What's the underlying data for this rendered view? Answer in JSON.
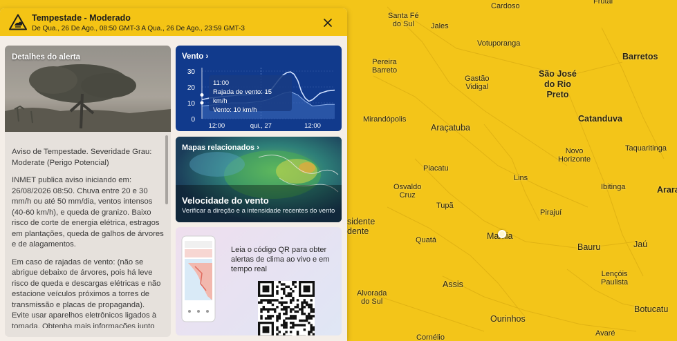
{
  "alert": {
    "title": "Tempestade - Moderado",
    "period": "De Qua., 26 De Ago., 08:50 GMT-3 A Qua., 26 De Ago., 23:59 GMT-3",
    "severity_color": "#f4c415"
  },
  "details": {
    "label": "Detalhes do alerta",
    "paragraphs": [
      "Aviso de Tempestade. Severidade Grau: Moderate (Perigo Potencial)",
      "INMET publica aviso iniciando em: 26/08/2026 08:50. Chuva entre 20 e 30 mm/h ou até 50 mm/dia, ventos intensos (40-60 km/h), e queda de granizo. Baixo risco de corte de energia elétrica, estragos em plantações, queda de galhos de árvores e de alagamentos.",
      "Em caso de rajadas de vento: (não se abrigue debaixo de árvores, pois há leve risco de queda e descargas elétricas e não estacione veículos próximos a torres de transmissão e placas de propaganda). Evite usar aparelhos eletrônicos ligados à tomada. Obtenha mais informações junto"
    ]
  },
  "wind": {
    "title": "Vento",
    "tooltip": {
      "time": "11:00",
      "gust": "Rajada de vento: 15 km/h",
      "wind": "Vento: 10 km/h"
    }
  },
  "chart_data": {
    "type": "line",
    "title": "Vento",
    "ylim": [
      0,
      30
    ],
    "yticks": [
      "30",
      "20",
      "10",
      "0"
    ],
    "xticks": [
      "12:00",
      "qui., 27",
      "12:00"
    ],
    "series": [
      {
        "name": "Rajada de vento",
        "x": [
          0,
          2,
          4,
          6,
          8,
          10,
          12,
          14,
          16,
          18,
          19,
          20,
          21,
          22,
          23,
          24,
          25,
          26,
          27,
          28,
          29,
          30,
          31,
          32,
          34,
          36
        ],
        "values": [
          12,
          13,
          13.5,
          14,
          14.5,
          15,
          15,
          15.5,
          16,
          17,
          19,
          22,
          25,
          27.5,
          29,
          29.5,
          28,
          24,
          17,
          13,
          11,
          12,
          14,
          16,
          17.5,
          18
        ]
      },
      {
        "name": "Vento",
        "x": [
          0,
          2,
          4,
          6,
          8,
          10,
          12,
          14,
          16,
          18,
          20,
          22,
          24,
          26,
          28,
          30,
          32,
          34,
          36
        ],
        "values": [
          8,
          8.5,
          9,
          9.5,
          10,
          10,
          10,
          10.5,
          11,
          12,
          14,
          16,
          17,
          15,
          11,
          8,
          8.5,
          9,
          9
        ]
      }
    ]
  },
  "maps": {
    "title": "Mapas relacionados",
    "name": "Velocidade do vento",
    "desc": "Verificar a direção e a intensidade recentes do vento"
  },
  "qr": {
    "text": "Leia o código QR para obter alertas de clima ao vivo e em tempo real"
  },
  "map": {
    "cities": [
      {
        "name": "Cardoso",
        "cls": ""
      },
      {
        "name": "Frutal",
        "cls": ""
      },
      {
        "name": "Santa Fé\ndo Sul",
        "cls": ""
      },
      {
        "name": "Jales",
        "cls": ""
      },
      {
        "name": "Votuporanga",
        "cls": ""
      },
      {
        "name": "Barretos",
        "cls": "big"
      },
      {
        "name": "Pereira\nBarreto",
        "cls": ""
      },
      {
        "name": "São José\ndo Rio\nPreto",
        "cls": "big"
      },
      {
        "name": "Gastão\nVidigal",
        "cls": ""
      },
      {
        "name": "Mirandópolis",
        "cls": ""
      },
      {
        "name": "Araçatuba",
        "cls": "mid"
      },
      {
        "name": "Catanduva",
        "cls": "big"
      },
      {
        "name": "Novo\nHorizonte",
        "cls": ""
      },
      {
        "name": "Taquaritinga",
        "cls": ""
      },
      {
        "name": "Piacatu",
        "cls": ""
      },
      {
        "name": "Lins",
        "cls": ""
      },
      {
        "name": "Osvaldo\nCruz",
        "cls": ""
      },
      {
        "name": "Ibitinga",
        "cls": ""
      },
      {
        "name": "Arara",
        "cls": "big"
      },
      {
        "name": "Tupã",
        "cls": ""
      },
      {
        "name": "Pirajuí",
        "cls": ""
      },
      {
        "name": "sidente\ndente",
        "cls": "mid"
      },
      {
        "name": "Quatá",
        "cls": ""
      },
      {
        "name": "Marília",
        "cls": "mid"
      },
      {
        "name": "Bauru",
        "cls": "mid"
      },
      {
        "name": "Jaú",
        "cls": "mid"
      },
      {
        "name": "Lençóis\nPaulista",
        "cls": ""
      },
      {
        "name": "Assis",
        "cls": "mid"
      },
      {
        "name": "Alvorada\ndo Sul",
        "cls": ""
      },
      {
        "name": "Botucatu",
        "cls": "mid"
      },
      {
        "name": "Ourinhos",
        "cls": "mid"
      },
      {
        "name": "Avaré",
        "cls": ""
      },
      {
        "name": "Cornélio",
        "cls": ""
      }
    ]
  }
}
